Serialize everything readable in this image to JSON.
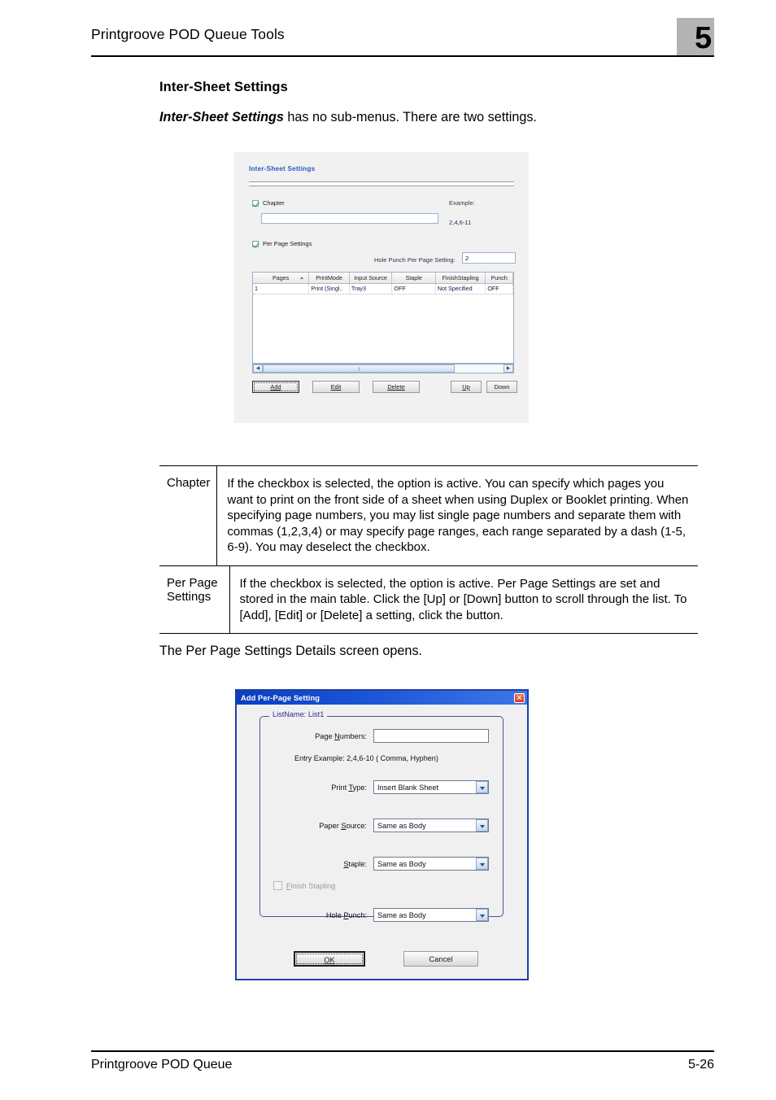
{
  "header": {
    "title": "Printgroove POD Queue Tools",
    "chapter_number": "5"
  },
  "section": {
    "heading": "Inter-Sheet Settings",
    "intro_emphasis": "Inter-Sheet Settings",
    "intro_rest": " has no sub-menus. There are two settings."
  },
  "figure_inter_sheet": {
    "title": "Inter-Sheet Settings",
    "chapter_checkbox_label": "Chapter",
    "chapter_textbox_value": "",
    "example_label": "Example:",
    "example_value": "2,4,6-11",
    "per_page_checkbox_label": "Per Page Settings",
    "hole_punch_label": "Hole Punch Per Page Setting:",
    "hole_punch_value": "2",
    "grid": {
      "columns": [
        "Pages",
        "PrintMode",
        "Input Source",
        "Staple",
        "FinishStapling",
        "Punch"
      ],
      "rows": [
        [
          "1",
          "Print (Singl..",
          "Tray3",
          "OFF",
          "Not Specified",
          "OFF"
        ]
      ]
    },
    "buttons": {
      "add": "Add",
      "edit": "Edit",
      "delete": "Delete",
      "up": "Up",
      "down": "Down"
    },
    "scrollbar": {
      "left_arrow": "◀",
      "right_arrow": "▶"
    }
  },
  "description_table": {
    "rows": [
      {
        "term": "Chapter",
        "description": "If the checkbox is selected, the option is active. You can specify which pages you want to print on the front side of a sheet when using Duplex or Booklet printing. When specifying page numbers, you may list single page numbers and separate them with commas (1,2,3,4) or may specify page ranges, each range separated by a dash (1-5, 6-9). You may deselect the checkbox."
      },
      {
        "term": "Per Page Settings",
        "description": "If the checkbox is selected, the option is active. Per Page Settings are set and stored in the main table. Click the [Up] or [Down] button to scroll through the list. To [Add], [Edit] or [Delete] a setting, click the button."
      }
    ]
  },
  "after_table_text": "The Per Page Settings Details screen opens.",
  "figure_dialog": {
    "title": "Add Per-Page Setting",
    "close_icon": "close-icon",
    "group_legend": "ListName: List1",
    "fields": {
      "page_numbers_label": "Page Numbers:",
      "page_numbers_value": "",
      "entry_example": "Entry Example: 2,4,6-10 ( Comma, Hyphen)",
      "print_type_label": "Print Type:",
      "print_type_value": "Insert Blank Sheet",
      "paper_source_label": "Paper Source:",
      "paper_source_value": "Same as Body",
      "staple_label": "Staple:",
      "staple_value": "Same as Body",
      "finish_stapling_label": "Finish Stapling",
      "hole_punch_label": "Hole Punch:",
      "hole_punch_value": "Same as Body"
    },
    "buttons": {
      "ok": "OK",
      "cancel": "Cancel"
    }
  },
  "footer": {
    "left": "Printgroove POD Queue",
    "right": "5-26"
  }
}
